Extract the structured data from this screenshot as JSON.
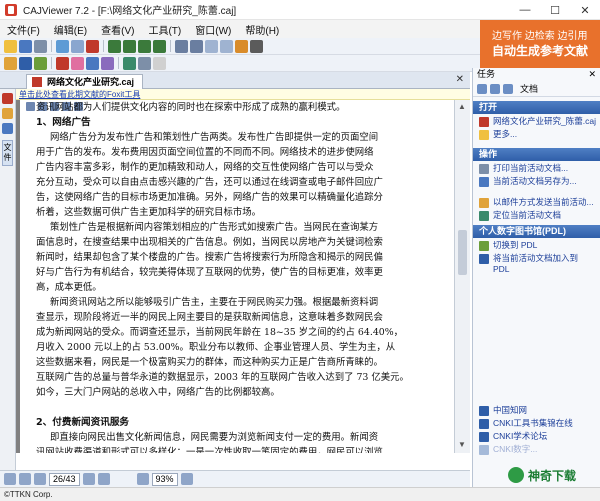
{
  "window": {
    "title": "CAJViewer 7.2 - [F:\\网络文化产业研究_陈蕾.caj]",
    "controls": [
      "—",
      "☐",
      "✕"
    ]
  },
  "menu": [
    "文件(F)",
    "编辑(E)",
    "查看(V)",
    "工具(T)",
    "窗口(W)",
    "帮助(H)"
  ],
  "banner": {
    "line1": "边写作  边检索  边引用",
    "line2": "自动生成参考文献",
    "color": "#e8712c"
  },
  "tab": {
    "label": "网络文化产业研究.caj",
    "close": "✕"
  },
  "notice": "单击此处查看此期文献的Foxit工具",
  "sidebar": {
    "vertical_tab": "文件"
  },
  "document": {
    "lines": [
      {
        "t": "资讯网站都为人们提供文化内容的同时也在探索中形成了成熟的赢利模式。",
        "c": ""
      },
      {
        "t": "1、网络广告",
        "c": "h"
      },
      {
        "t": "网络广告分为发布性广告和策划性广告两类。发布性广告即提供一定的页面空间",
        "c": "ind"
      },
      {
        "t": "用于广告的发布。发布费用因页面空间位置的不同而不同。网络技术的进步使网络",
        "c": ""
      },
      {
        "t": "广告内容丰富多彩，制作的更加精致和动人，网络的交互性使网络广告可以与受众",
        "c": ""
      },
      {
        "t": "充分互动，受众可以自由点击感兴趣的广告，还可以通过在线调查或电子邮件回应广",
        "c": ""
      },
      {
        "t": "告，这使网络广告的目标市场更加准确。另外，网络广告的效果可以精确量化追踪分",
        "c": ""
      },
      {
        "t": "析着，这些数据可供广告主更加科学的研究目标市场。",
        "c": ""
      },
      {
        "t": "策划性广告是根据新闻内容策划相应的广告形式如搜索广告。当网民在查询某方",
        "c": "ind"
      },
      {
        "t": "面信息时，在搜查结果中出现相关的广告信息。例如，当网民以房地产为关键词检索",
        "c": ""
      },
      {
        "t": "新闻时，结果却包含了某个楼盘的广告。搜索广告将搜索行为所隐含和揭示的网民偏",
        "c": ""
      },
      {
        "t": "好与广告行为有机结合，较完美得体现了互联网的优势，使广告的目标更准，效率更",
        "c": ""
      },
      {
        "t": "高，成本更低。",
        "c": ""
      },
      {
        "t": "新闻资讯网站之所以能够吸引广告主，主要在于网民购买力强。根据最新资料调",
        "c": "ind"
      },
      {
        "t": "查显示，现阶段将近一半的网民上网主要目的是获取新闻信息，这意味着多数网民会",
        "c": ""
      },
      {
        "t": "成为新闻网站的受众。而调查还显示，当前网民年龄在 18~35 岁之间的约占 64.40%，",
        "c": ""
      },
      {
        "t": "月收入 2000 元以上的占 53.00%。职业分布以教师、企事业管理人员、学生为主，从",
        "c": ""
      },
      {
        "t": "这些数据来看，网民是一个极富购买力的群体，而这种购买力正是广告商所青睐的。",
        "c": ""
      },
      {
        "t": "互联网广告的总量与普华永道的数据显示，2003 年的互联网广告收入达到了 73 亿美元。",
        "c": ""
      },
      {
        "t": "如今，三大门户网站的总收入中，网络广告的比例都较高。",
        "c": ""
      },
      {
        "t": "",
        "c": ""
      },
      {
        "t": "2、付费新闻资讯服务",
        "c": "h"
      },
      {
        "t": "即直接向网民出售文化新闻信息，网民需要为浏览新闻支付一定的费用。新闻资",
        "c": "ind"
      },
      {
        "t": "讯网站收费渠道和形式可以多样化：一是一次性收取一笔固定的费用，网民可以浏览",
        "c": ""
      }
    ]
  },
  "status": {
    "page": "26/43",
    "zoom": "93%",
    "copyright": "©TTKN Corp."
  },
  "tasks": {
    "title": "任务",
    "close": "✕",
    "nav_label": "文档",
    "sections": [
      {
        "title": "打开",
        "items": [
          "网络文化产业研究_陈蕾.caj",
          "更多..."
        ]
      },
      {
        "title": "操作",
        "items": [
          "打印当前活动文档...",
          "当前活动文档另存为...",
          "",
          "以邮件方式发送当前活动...",
          "定位当前活动文档"
        ]
      },
      {
        "title": "个人数字图书馆(PDL)",
        "items": [
          "切换到 PDL",
          "将当前活动文档加入到 PDL"
        ]
      }
    ],
    "links": [
      "中国知网",
      "CNKI工具书集锦在线",
      "CNKI学术论坛",
      "CNKI数字..."
    ]
  },
  "watermark": "神奇下载"
}
